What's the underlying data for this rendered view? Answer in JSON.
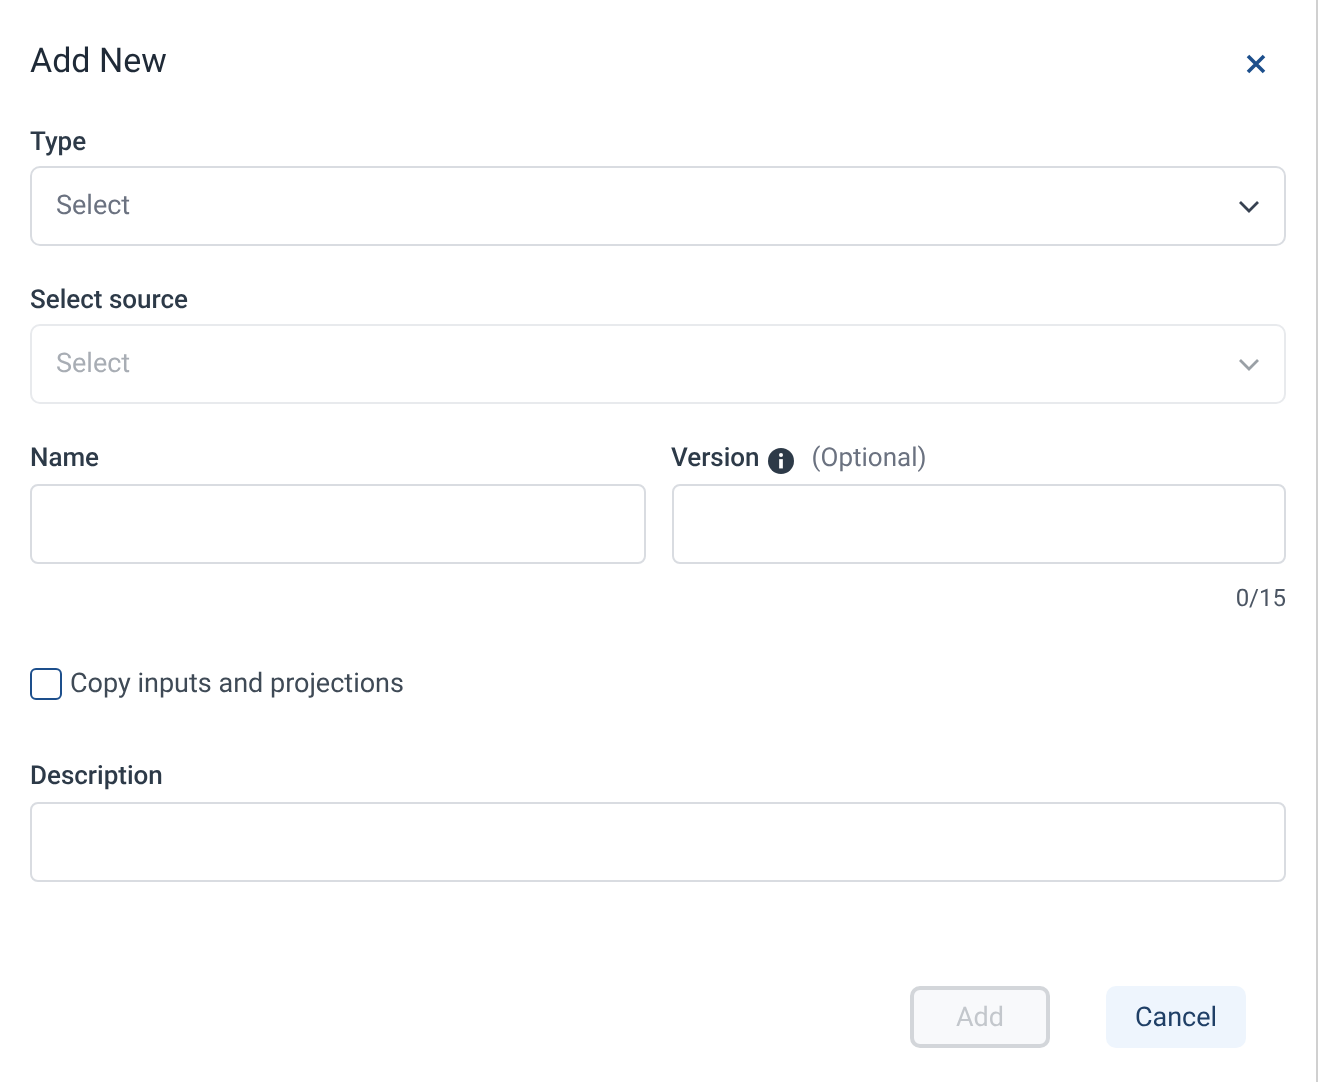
{
  "dialog": {
    "title": "Add New"
  },
  "type_field": {
    "label": "Type",
    "placeholder": "Select",
    "disabled": false
  },
  "source_field": {
    "label": "Select source",
    "placeholder": "Select",
    "disabled": true
  },
  "name_field": {
    "label": "Name"
  },
  "version_field": {
    "label": "Version",
    "hint": "(Optional)",
    "counter": "0/15"
  },
  "copy_checkbox": {
    "label": "Copy inputs and projections",
    "checked": false
  },
  "description_field": {
    "label": "Description"
  },
  "buttons": [
    {
      "label": "Add",
      "disabled": true
    },
    {
      "label": "Cancel",
      "disabled": false
    }
  ]
}
